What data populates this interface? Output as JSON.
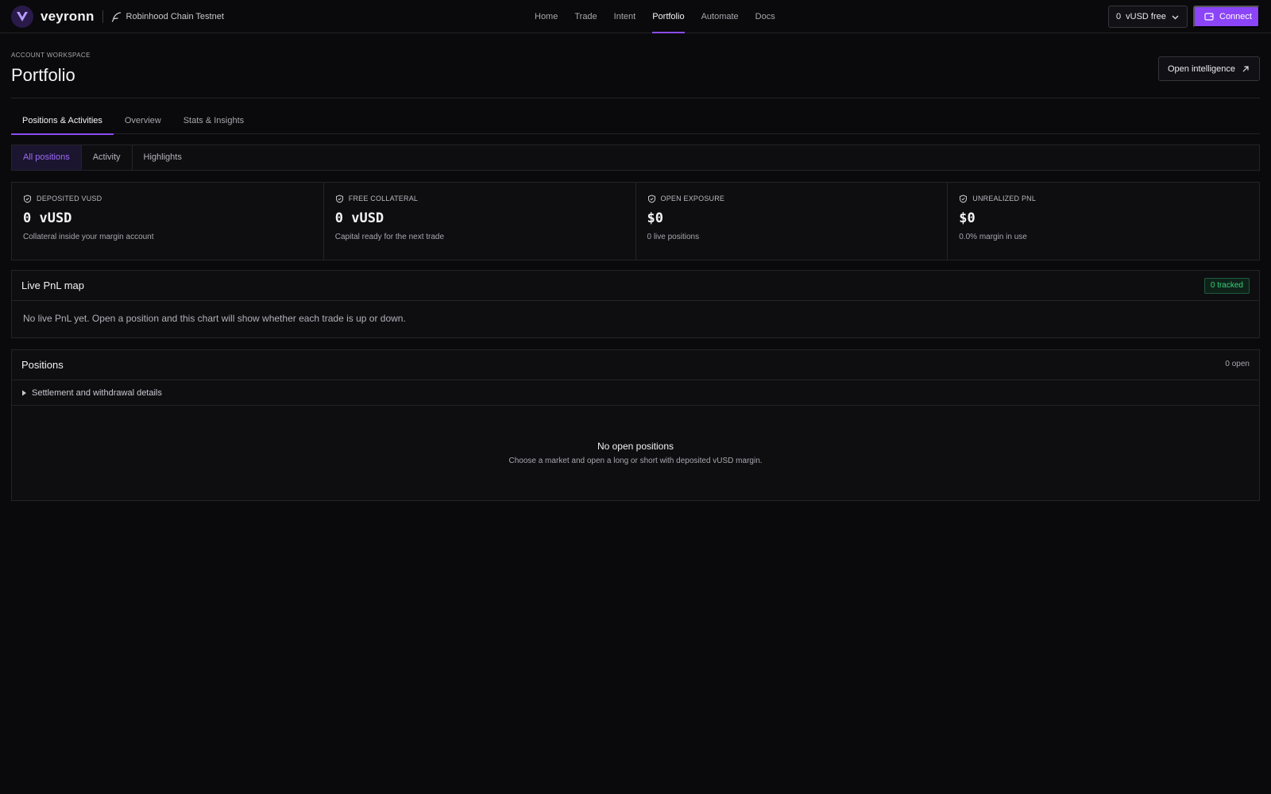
{
  "brand": {
    "name": "veyronn",
    "network": "Robinhood Chain Testnet",
    "logo_icon": "veyronn-logo-icon",
    "network_icon": "feather-icon"
  },
  "nav": {
    "items": [
      {
        "label": "Home",
        "active": false
      },
      {
        "label": "Trade",
        "active": false
      },
      {
        "label": "Intent",
        "active": false
      },
      {
        "label": "Portfolio",
        "active": true
      },
      {
        "label": "Automate",
        "active": false
      },
      {
        "label": "Docs",
        "active": false
      }
    ],
    "balance_amount": "0",
    "balance_label": "vUSD free",
    "connect_label": "Connect"
  },
  "header": {
    "eyebrow": "ACCOUNT WORKSPACE",
    "title": "Portfolio",
    "intelligence_label": "Open intelligence"
  },
  "tabs": [
    {
      "label": "Positions & Activities",
      "active": true
    },
    {
      "label": "Overview",
      "active": false
    },
    {
      "label": "Stats & Insights",
      "active": false
    }
  ],
  "subtabs": [
    {
      "label": "All positions",
      "active": true
    },
    {
      "label": "Activity",
      "active": false
    },
    {
      "label": "Highlights",
      "active": false
    }
  ],
  "stats": [
    {
      "label": "DEPOSITED VUSD",
      "value": "0 vUSD",
      "sub": "Collateral inside your margin account"
    },
    {
      "label": "FREE COLLATERAL",
      "value": "0 vUSD",
      "sub": "Capital ready for the next trade"
    },
    {
      "label": "OPEN EXPOSURE",
      "value": "$0",
      "sub": "0 live positions"
    },
    {
      "label": "UNREALIZED PNL",
      "value": "$0",
      "sub": "0.0% margin in use"
    }
  ],
  "pnl_map": {
    "title": "Live PnL map",
    "badge": "0 tracked",
    "note": "No live PnL yet. Open a position and this chart will show whether each trade is up or down."
  },
  "positions": {
    "title": "Positions",
    "count": "0 open",
    "details_label": "Settlement and withdrawal details",
    "empty_title": "No open positions",
    "empty_sub": "Choose a market and open a long or short with deposited vUSD margin."
  },
  "colors": {
    "accent": "#8b44f7",
    "positive": "#34d27a",
    "background": "#0a0a0c",
    "surface": "#0e0e11",
    "border": "#23232a"
  }
}
